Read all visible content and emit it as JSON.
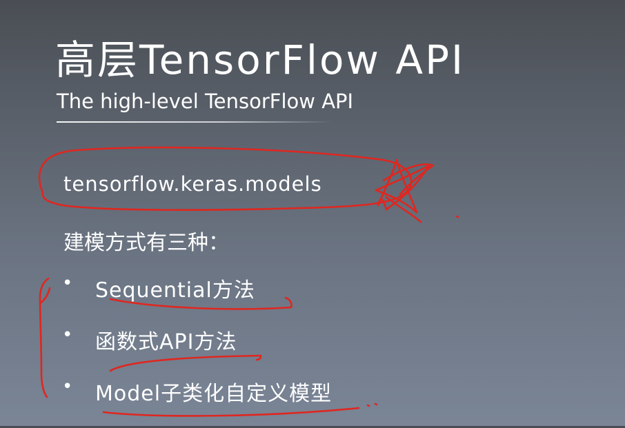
{
  "slide": {
    "title": "高层TensorFlow API",
    "subtitle": "The high-level TensorFlow  API",
    "module": "tensorflow.keras.models",
    "intro": "建模方式有三种：",
    "bullet_glyph": "•",
    "methods": [
      "Sequential方法",
      "函数式API方法",
      "Model子类化自定义模型"
    ]
  },
  "colors": {
    "background_top": "#4a4e54",
    "background_bottom": "#7a8596",
    "text": "#ffffff",
    "annotation_ink": "#e0261f"
  }
}
